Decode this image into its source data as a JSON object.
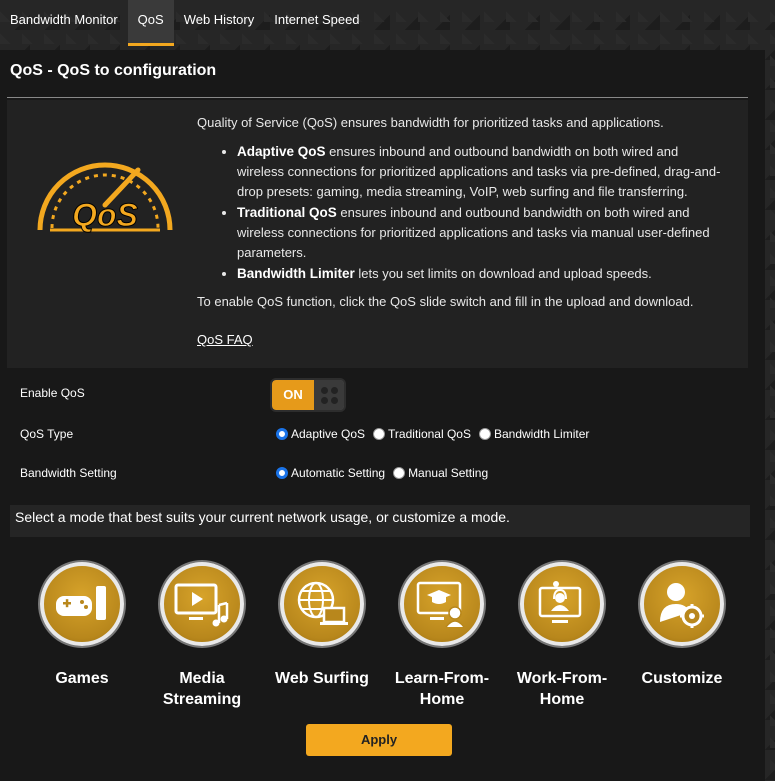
{
  "tabs": [
    {
      "label": "Bandwidth Monitor",
      "active": false
    },
    {
      "label": "QoS",
      "active": true
    },
    {
      "label": "Web History",
      "active": false
    },
    {
      "label": "Internet Speed",
      "active": false
    }
  ],
  "panel": {
    "title": "QoS - QoS to configuration",
    "intro": "Quality of Service (QoS) ensures bandwidth for prioritized tasks and applications.",
    "bullets": [
      {
        "term": "Adaptive QoS",
        "text": " ensures inbound and outbound bandwidth on both wired and wireless connections for prioritized applications and tasks via pre-defined, drag-and-drop presets: gaming, media streaming, VoIP, web surfing and file transferring."
      },
      {
        "term": "Traditional QoS",
        "text": " ensures inbound and outbound bandwidth on both wired and wireless connections for prioritized applications and tasks via manual user-defined parameters."
      },
      {
        "term": "Bandwidth Limiter",
        "text": " lets you set limits on download and upload speeds."
      }
    ],
    "enable_note": "To enable QoS function, click the QoS slide switch and fill in the upload and download.",
    "faq_link": "QoS FAQ",
    "logo_text": "QoS"
  },
  "settings": {
    "enable_label": "Enable QoS",
    "toggle_on": "ON",
    "qos_type_label": "QoS Type",
    "qos_types": [
      {
        "label": "Adaptive QoS",
        "selected": true
      },
      {
        "label": "Traditional QoS",
        "selected": false
      },
      {
        "label": "Bandwidth Limiter",
        "selected": false
      }
    ],
    "bandwidth_label": "Bandwidth Setting",
    "bandwidth_options": [
      {
        "label": "Automatic Setting",
        "selected": true
      },
      {
        "label": "Manual Setting",
        "selected": false
      }
    ]
  },
  "modes": {
    "prompt": "Select a mode that best suits your current network usage, or customize a mode.",
    "items": [
      {
        "label": "Games",
        "icon": "gamepad-icon"
      },
      {
        "label": "Media Streaming",
        "icon": "media-icon"
      },
      {
        "label": "Web Surfing",
        "icon": "globe-icon"
      },
      {
        "label": "Learn-From-Home",
        "icon": "learn-icon"
      },
      {
        "label": "Work-From-Home",
        "icon": "work-icon"
      },
      {
        "label": "Customize",
        "icon": "customize-icon"
      }
    ]
  },
  "apply_label": "Apply",
  "colors": {
    "accent": "#f3a81f",
    "radio_selected": "#1a73e8"
  }
}
